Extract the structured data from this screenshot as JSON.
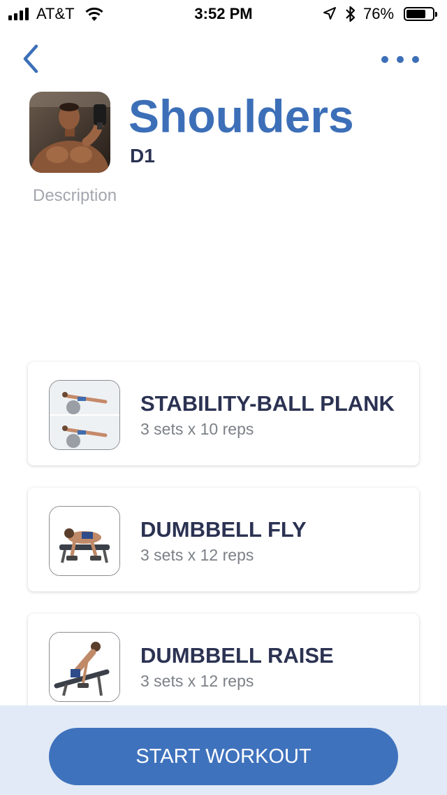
{
  "status_bar": {
    "carrier": "AT&T",
    "time": "3:52 PM",
    "battery_percent": "76%",
    "battery_level": 0.76,
    "icons": [
      "signal-icon",
      "wifi-icon",
      "location-icon",
      "bluetooth-icon",
      "battery-icon"
    ]
  },
  "nav": {
    "back_icon": "chevron-left-icon",
    "more_icon": "ellipsis-icon"
  },
  "workout": {
    "title": "Shoulders",
    "subtitle": "D1",
    "description_placeholder": "Description"
  },
  "exercises": [
    {
      "name": "STABILITY-BALL PLANK",
      "detail": "3 sets x 10 reps"
    },
    {
      "name": "DUMBBELL FLY",
      "detail": "3 sets x 12 reps"
    },
    {
      "name": "DUMBBELL RAISE",
      "detail": "3 sets x 12 reps"
    }
  ],
  "footer": {
    "start_label": "START WORKOUT"
  },
  "colors": {
    "accent": "#3c6fb8",
    "text_dark": "#2b3252",
    "footer_bg": "#e1eaf6"
  }
}
